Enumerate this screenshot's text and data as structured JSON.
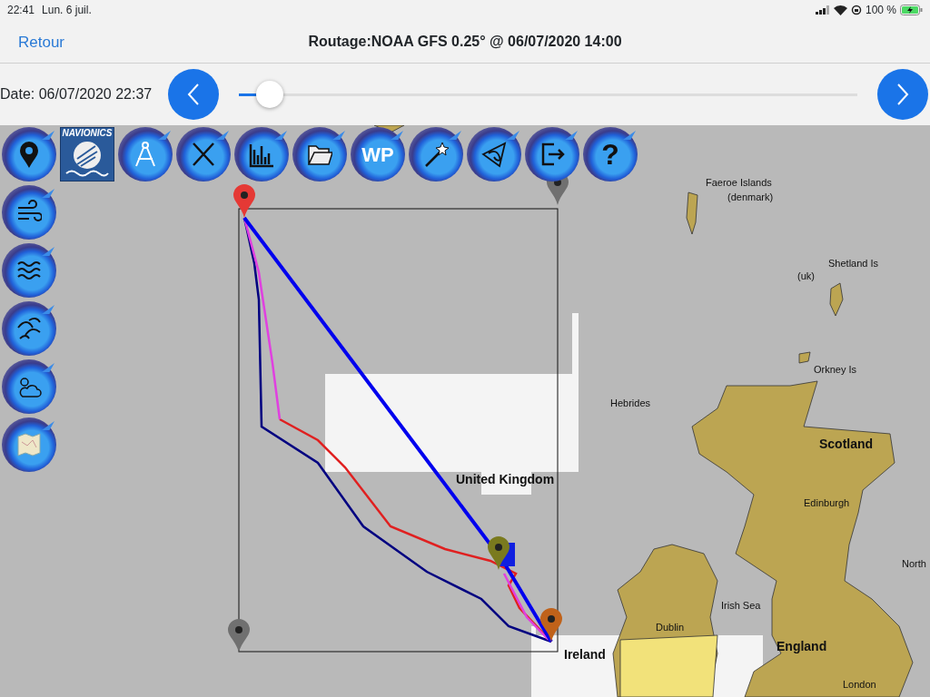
{
  "status_bar": {
    "time": "22:41",
    "date": "Lun. 6 juil.",
    "battery": "100 %",
    "charging": true
  },
  "nav": {
    "back": "Retour",
    "title": "Routage:NOAA GFS 0.25° @ 06/07/2020 14:00"
  },
  "timeline": {
    "date": "Date: 06/07/2020 22:37",
    "level": 0.05
  },
  "toolbar": [
    {
      "kind": "pin"
    },
    {
      "kind": "navionics",
      "label": "NAVIONICS"
    },
    {
      "kind": "compass"
    },
    {
      "kind": "cross"
    },
    {
      "kind": "chart"
    },
    {
      "kind": "folder"
    },
    {
      "kind": "text",
      "label": "WP"
    },
    {
      "kind": "wand"
    },
    {
      "kind": "net"
    },
    {
      "kind": "exit"
    },
    {
      "kind": "text",
      "label": "?"
    }
  ],
  "sidebar": [
    {
      "kind": "wind"
    },
    {
      "kind": "waves"
    },
    {
      "kind": "swell"
    },
    {
      "kind": "weather"
    },
    {
      "kind": "map"
    }
  ],
  "map": {
    "labels": [
      {
        "text": "Faeroe Islands",
        "kind": "place"
      },
      {
        "text": "(denmark)",
        "kind": "place"
      },
      {
        "text": "Shetland Is",
        "kind": "place"
      },
      {
        "text": "(uk)",
        "kind": "place"
      },
      {
        "text": "Orkney Is",
        "kind": "place"
      },
      {
        "text": "Hebrides",
        "kind": "place"
      },
      {
        "text": "Scotland",
        "kind": "country"
      },
      {
        "text": "United Kingdom",
        "kind": "country"
      },
      {
        "text": "Edinburgh",
        "kind": "place"
      },
      {
        "text": "North",
        "kind": "place"
      },
      {
        "text": "Irish Sea",
        "kind": "place"
      },
      {
        "text": "Dublin",
        "kind": "place"
      },
      {
        "text": "England",
        "kind": "country"
      },
      {
        "text": "Ireland",
        "kind": "country"
      },
      {
        "text": "London",
        "kind": "place"
      }
    ],
    "markers": [
      {
        "color": "#e53935"
      },
      {
        "color": "#707070"
      },
      {
        "color": "#7a7a1e"
      },
      {
        "color": "#c0621a"
      },
      {
        "color": "#707070"
      }
    ],
    "routes": [
      {
        "color": "#0000ee"
      },
      {
        "color": "#000080"
      },
      {
        "color": "#e040e0"
      },
      {
        "color": "#e02020"
      }
    ]
  }
}
